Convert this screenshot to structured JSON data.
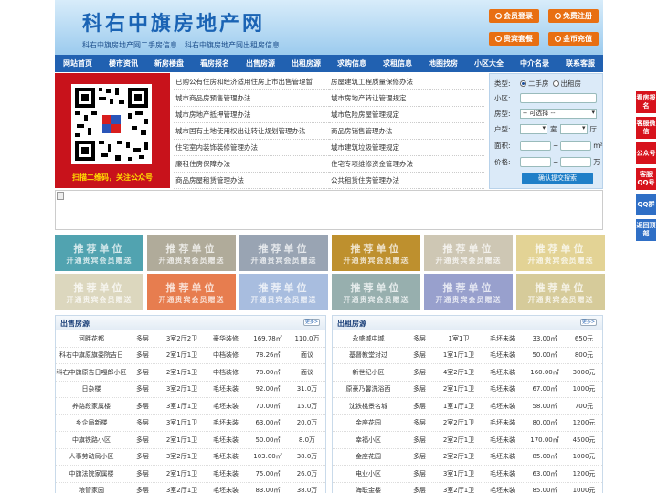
{
  "header": {
    "logo": "科右中旗房地产网",
    "tagline": "科右中旗房地产网二手房信息　科右中旗房地产网出租房信息",
    "buttons": [
      "会员登录",
      "免费注册",
      "贵宾套餐",
      "金币充值"
    ]
  },
  "nav": [
    "网站首页",
    "楼市资讯",
    "新房楼盘",
    "看房报名",
    "出售房源",
    "出租房源",
    "求购信息",
    "求租信息",
    "地图找房",
    "小区大全",
    "中介名录",
    "联系客服"
  ],
  "qr": {
    "caption": "扫描二维码，关注公众号"
  },
  "links": [
    "已购公有住房和经济适用住房上市出售管理暂",
    "房屋建筑工程质量保修办法",
    "城市商品房预售管理办法",
    "城市房地产转让管理规定",
    "城市房地产抵押管理办法",
    "城市危险房屋管理规定",
    "城市国有土地使用权出让转让规划管理办法",
    "商品房销售管理办法",
    "住宅室内装饰装修管理办法",
    "城市建筑垃圾管理规定",
    "廉租住房保障办法",
    "住宅专项维修资金管理办法",
    "商品房屋租赁管理办法",
    "公共租赁住房管理办法"
  ],
  "search": {
    "type_label": "类型:",
    "type_options": [
      "二手房",
      "出租房"
    ],
    "community_label": "小区:",
    "room_label": "房型:",
    "room_select": "-- 可选择 --",
    "layout_label": "户型:",
    "layout_unit1": "室",
    "layout_unit2": "厅",
    "area_label": "面积:",
    "area_to": "~",
    "area_unit": "m²",
    "price_label": "价格:",
    "price_to": "~",
    "price_unit": "万",
    "submit": "确认提交搜索"
  },
  "recommend": {
    "line1": "推荐单位",
    "line2": "开通贵宾会员赠送",
    "colors": [
      "#3f9aa8",
      "#a8a290",
      "#8e9bab",
      "#b88418",
      "#c9c1ac",
      "#e0cf8a",
      "#d9d3b8",
      "#e56f3c",
      "#9fb6dc",
      "#8ca7a6",
      "#8d96c8",
      "#d2c690"
    ]
  },
  "sale": {
    "title": "出售房源",
    "more": "更多>",
    "rows": [
      [
        "河畔花都",
        "多层",
        "3室2厅2卫",
        "豪华装修",
        "169.78㎡",
        "110.0万"
      ],
      [
        "科右中旗原旗委院吉日",
        "多层",
        "2室1厅1卫",
        "中档装修",
        "78.26㎡",
        "面议"
      ],
      [
        "科右中旗原吉日嘎郎小区",
        "多层",
        "2室1厅1卫",
        "中档装修",
        "78.00㎡",
        "面议"
      ],
      [
        "日杂楼",
        "多层",
        "3室2厅1卫",
        "毛坯未装",
        "92.00㎡",
        "31.0万"
      ],
      [
        "养路段家属楼",
        "多层",
        "3室1厅1卫",
        "毛坯未装",
        "70.00㎡",
        "15.0万"
      ],
      [
        "乡企局新楼",
        "多层",
        "3室1厅1卫",
        "毛坯未装",
        "63.00㎡",
        "20.0万"
      ],
      [
        "中旗铁路小区",
        "多层",
        "2室1厅1卫",
        "毛坯未装",
        "50.00㎡",
        "8.0万"
      ],
      [
        "人事劳动局小区",
        "多层",
        "3室2厅1卫",
        "毛坯未装",
        "103.00㎡",
        "38.0万"
      ],
      [
        "中旗法院家属楼",
        "多层",
        "2室1厅1卫",
        "毛坯未装",
        "75.00㎡",
        "26.0万"
      ],
      [
        "粮管家园",
        "多层",
        "3室2厅1卫",
        "毛坯未装",
        "83.00㎡",
        "38.0万"
      ]
    ]
  },
  "rent": {
    "title": "出租房源",
    "more": "更多>",
    "rows": [
      [
        "永盛城中城",
        "多层",
        "1室1卫",
        "毛坯未装",
        "33.00㎡",
        "650元"
      ],
      [
        "基督教堂对过",
        "多层",
        "1室1厅1卫",
        "毛坯未装",
        "50.00㎡",
        "800元"
      ],
      [
        "新世纪小区",
        "多层",
        "4室2厅1卫",
        "毛坯未装",
        "160.00㎡",
        "3000元"
      ],
      [
        "原豪乃馨洗浴西",
        "多层",
        "2室1厅1卫",
        "毛坯未装",
        "67.00㎡",
        "1000元"
      ],
      [
        "沈铁桃景名城",
        "多层",
        "1室1厅1卫",
        "毛坯未装",
        "58.00㎡",
        "700元"
      ],
      [
        "金座花园",
        "多层",
        "2室2厅1卫",
        "毛坯未装",
        "80.00㎡",
        "1200元"
      ],
      [
        "幸福小区",
        "多层",
        "2室2厅1卫",
        "毛坯未装",
        "170.00㎡",
        "4500元"
      ],
      [
        "金座花园",
        "多层",
        "2室2厅1卫",
        "毛坯未装",
        "85.00㎡",
        "1000元"
      ],
      [
        "电业小区",
        "多层",
        "3室1厅1卫",
        "毛坯未装",
        "63.00㎡",
        "1200元"
      ],
      [
        "海联金楼",
        "多层",
        "3室2厅1卫",
        "毛坯未装",
        "85.00㎡",
        "1000元"
      ]
    ]
  },
  "side": [
    "看房报名",
    "客服微信",
    "公众号",
    "客服QQ号",
    "QQ群",
    "返回顶部"
  ]
}
